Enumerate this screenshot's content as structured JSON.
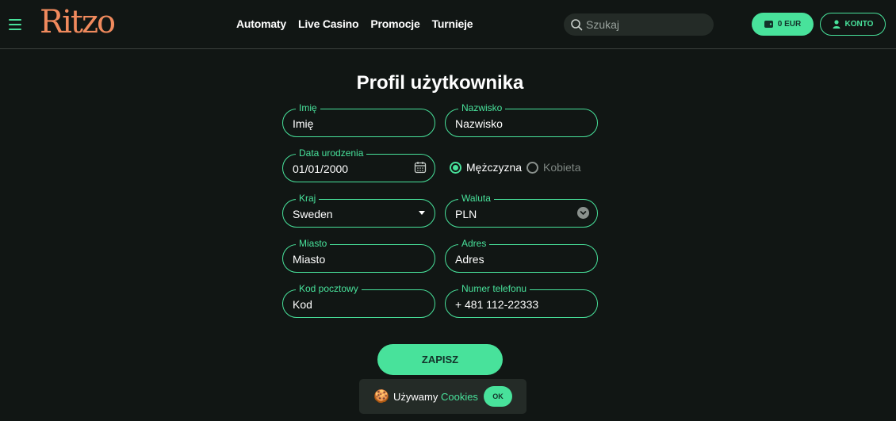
{
  "brand": {
    "logo_text": "Ritzo",
    "accent": "#48e29b",
    "logo_color": "#f08a5d"
  },
  "header": {
    "nav": [
      "Automaty",
      "Live Casino",
      "Promocje",
      "Turnieje"
    ],
    "search_placeholder": "Szukaj",
    "wallet_label": "0 EUR",
    "account_label": "KONTO"
  },
  "page": {
    "title": "Profil użytkownika"
  },
  "form": {
    "first_name": {
      "label": "Imię",
      "value": "Imię"
    },
    "last_name": {
      "label": "Nazwisko",
      "value": "Nazwisko"
    },
    "birth_date": {
      "label": "Data urodzenia",
      "value": "01/01/2000"
    },
    "gender": {
      "male": "Mężczyzna",
      "female": "Kobieta",
      "selected": "male"
    },
    "country": {
      "label": "Kraj",
      "value": "Sweden"
    },
    "currency": {
      "label": "Waluta",
      "value": "PLN"
    },
    "city": {
      "label": "Miasto",
      "value": "Miasto"
    },
    "address": {
      "label": "Adres",
      "value": "Adres"
    },
    "postal": {
      "label": "Kod pocztowy",
      "value": "Kod"
    },
    "phone": {
      "label": "Numer telefonu",
      "prefix": "+",
      "value": "481 112-22333"
    },
    "save_label": "ZAPISZ"
  },
  "cookie": {
    "icon": "cookie-icon",
    "text": "Używamy",
    "link": "Cookies",
    "ok_label": "OK"
  }
}
